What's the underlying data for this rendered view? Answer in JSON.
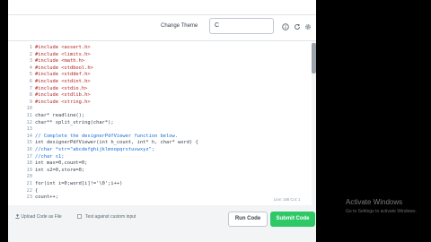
{
  "toolbar": {
    "change_theme": "Change Theme",
    "language": "C",
    "icons": [
      "info-icon",
      "reset-icon",
      "settings-icon"
    ]
  },
  "editor": {
    "lines": [
      {
        "num": "1",
        "code": "#include <assert.h>"
      },
      {
        "num": "2",
        "code": "#include <limits.h>"
      },
      {
        "num": "3",
        "code": "#include <math.h>"
      },
      {
        "num": "4",
        "code": "#include <stdbool.h>"
      },
      {
        "num": "5",
        "code": "#include <stddef.h>"
      },
      {
        "num": "6",
        "code": "#include <stdint.h>"
      },
      {
        "num": "7",
        "code": "#include <stdio.h>"
      },
      {
        "num": "8",
        "code": "#include <stdlib.h>"
      },
      {
        "num": "9",
        "code": "#include <string.h>"
      },
      {
        "num": "10",
        "code": ""
      },
      {
        "num": "11",
        "code": "char* readline();"
      },
      {
        "num": "12",
        "code": "char** split_string(char*);"
      },
      {
        "num": "13",
        "code": ""
      },
      {
        "num": "14",
        "code": "// Complete the designerPdfViewer function below."
      },
      {
        "num": "15",
        "code": "int designerPdfViewer(int h_count, int* h, char* word) {"
      },
      {
        "num": "16",
        "code": "//char *str=\"abcdefghijklmnopqrstuvwxyz\";"
      },
      {
        "num": "17",
        "code": "//char s1;"
      },
      {
        "num": "18",
        "code": "int max=0,count=0;"
      },
      {
        "num": "19",
        "code": "int s2=0,store=0;"
      },
      {
        "num": "20",
        "code": ""
      },
      {
        "num": "21",
        "code": "for(int i=0;word[i]!='\\0';i++)"
      },
      {
        "num": "22",
        "code": "{"
      },
      {
        "num": "23",
        "code": "count++;"
      }
    ],
    "status": "Line: 168 Col: 1"
  },
  "footer": {
    "upload": "Upload Code as File",
    "test_label": "Test against custom input",
    "run": "Run Code",
    "submit": "Submit Code"
  },
  "watermark": {
    "title": "Activate Windows",
    "subtitle": "Go to Settings to activate Windows."
  },
  "colors": {
    "keyword": "#0000c8",
    "header": "#b22222",
    "comment": "#1a6ed8",
    "submit": "#2ec866"
  }
}
